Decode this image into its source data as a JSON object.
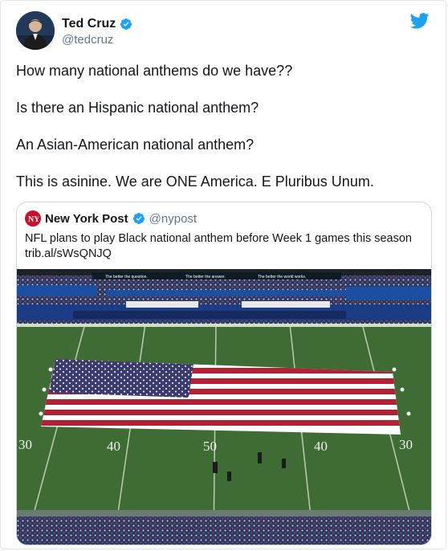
{
  "tweet": {
    "author_name": "Ted Cruz",
    "author_handle": "@tedcruz",
    "text_lines": [
      "How many national anthems do we have??",
      "Is there an Hispanic national anthem?",
      "An Asian-American national anthem?",
      "This is asinine. We are ONE America. E Pluribus Unum."
    ]
  },
  "quoted_tweet": {
    "author_name": "New York Post",
    "author_handle": "@nypost",
    "text": "NFL plans to play Black national anthem before Week 1 games this season",
    "link": "trib.al/sWsQNJQ",
    "image": {
      "banner_texts": [
        "The better the question.",
        "The better the answer.",
        "The better the world works."
      ],
      "yard_numbers": [
        "30",
        "40",
        "50",
        "40",
        "30"
      ]
    }
  },
  "icons": {
    "verified": "verified-badge-icon",
    "brand": "twitter-bird-icon"
  },
  "colors": {
    "verified": "#1da1f2",
    "twitter_blue": "#1da1f2",
    "field_green": "#3f6b35",
    "flag_red": "#b22234",
    "flag_blue": "#3c3b6e"
  }
}
